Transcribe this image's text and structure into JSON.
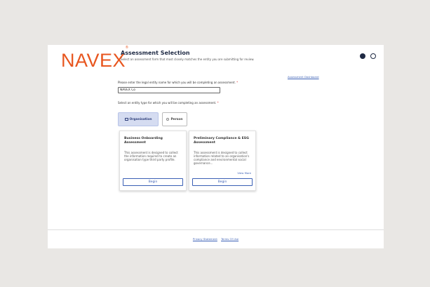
{
  "header": {
    "logo": "NAVEX",
    "logo_mark": "®",
    "title": "Assessment Selection",
    "subtitle": "Select an assessment form that most closely matches the entity you are submitting for review."
  },
  "links": {
    "dashboard": "Assessment Dashboard"
  },
  "entity_question": {
    "label": "Please enter the legal entity name for which you will be completing an assessment.",
    "required": "*",
    "value": "NAVEX Co"
  },
  "type_question": {
    "label": "Select an entity type for which you will be completing an assessment.",
    "required": "*"
  },
  "entity_types": [
    {
      "label": "Organisation",
      "selected": true
    },
    {
      "label": "Person",
      "selected": false
    }
  ],
  "cards": [
    {
      "title": "Business Onboarding Assessment",
      "description": "This assessment is designed to collect the information required to create an organisation type third party profile.",
      "button": "Begin"
    },
    {
      "title": "Preliminary Compliance & ESG Assessment",
      "description": "This assessment is designed to collect information related to an organisation's compliance and environmental social governance...",
      "view_more": "View More",
      "button": "Begin"
    }
  ],
  "footer": {
    "privacy": "Privacy Statement",
    "terms": "Terms Of Use"
  }
}
